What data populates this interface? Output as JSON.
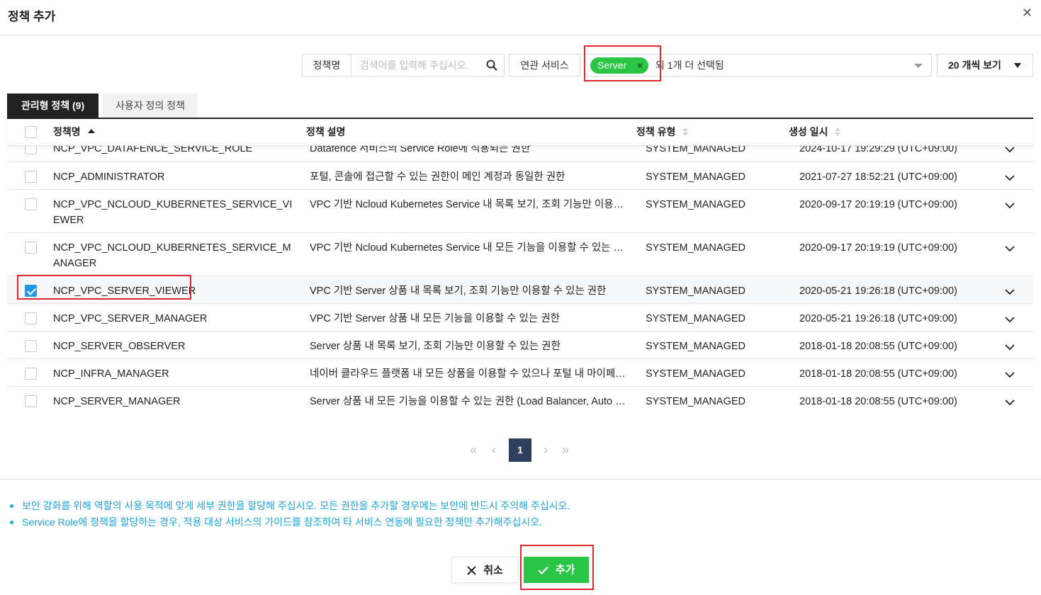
{
  "dialog": {
    "title": "정책 추가",
    "close_glyph": "✕"
  },
  "filter": {
    "search_label": "정책명",
    "search_placeholder": "검색어를 입력해 주십시오.",
    "service_label": "연관 서비스",
    "service_chip": "Server",
    "service_chip_remove": "×",
    "service_more": "외 1개 더 선택됨",
    "page_size": "20 개씩 보기"
  },
  "tabs": {
    "managed": "관리형 정책 (9)",
    "custom": "사용자 정의 정책"
  },
  "table": {
    "headers": {
      "name": "정책명",
      "desc": "정책 설명",
      "type": "정책 유형",
      "date": "생성 일시"
    },
    "rows": [
      {
        "name": "NCP_VPC_DATAFENCE_SERVICE_ROLE",
        "desc": "Datafence 서비스의 Service Role에 적용되는 권한",
        "type": "SYSTEM_MANAGED",
        "date": "2024-10-17 19:29:29 (UTC+09:00)",
        "checked": false
      },
      {
        "name": "NCP_ADMINISTRATOR",
        "desc": "포털, 콘솔에 접근할 수 있는 권한이 메인 계정과 동일한 권한",
        "type": "SYSTEM_MANAGED",
        "date": "2021-07-27 18:52:21 (UTC+09:00)",
        "checked": false
      },
      {
        "name": "NCP_VPC_NCLOUD_KUBERNETES_SERVICE_VIEWER",
        "desc": "VPC 기반 Ncloud Kubernetes Service 내 목록 보기, 조회 기능만 이용할 수 있는 권한",
        "type": "SYSTEM_MANAGED",
        "date": "2020-09-17 20:19:19 (UTC+09:00)",
        "checked": false
      },
      {
        "name": "NCP_VPC_NCLOUD_KUBERNETES_SERVICE_MANAGER",
        "desc": "VPC 기반 Ncloud Kubernetes Service 내 모든 기능을 이용할 수 있는 권한",
        "type": "SYSTEM_MANAGED",
        "date": "2020-09-17 20:19:19 (UTC+09:00)",
        "checked": false
      },
      {
        "name": "NCP_VPC_SERVER_VIEWER",
        "desc": "VPC 기반 Server 상품 내 목록 보기, 조회 기능만 이용할 수 있는 권한",
        "type": "SYSTEM_MANAGED",
        "date": "2020-05-21 19:26:18 (UTC+09:00)",
        "checked": true
      },
      {
        "name": "NCP_VPC_SERVER_MANAGER",
        "desc": "VPC 기반 Server 상품 내 모든 기능을 이용할 수 있는 권한",
        "type": "SYSTEM_MANAGED",
        "date": "2020-05-21 19:26:18 (UTC+09:00)",
        "checked": false
      },
      {
        "name": "NCP_SERVER_OBSERVER",
        "desc": "Server 상품 내 목록 보기, 조회 기능만 이용할 수 있는 권한",
        "type": "SYSTEM_MANAGED",
        "date": "2018-01-18 20:08:55 (UTC+09:00)",
        "checked": false
      },
      {
        "name": "NCP_INFRA_MANAGER",
        "desc": "네이버 클라우드 플랫폼 내 모든 상품을 이용할 수 있으나 포털 내 마이페이지 이용은 제한되는 권한",
        "type": "SYSTEM_MANAGED",
        "date": "2018-01-18 20:08:55 (UTC+09:00)",
        "checked": false
      },
      {
        "name": "NCP_SERVER_MANAGER",
        "desc": "Server 상품 내 모든 기능을 이용할 수 있는 권한 (Load Balancer, Auto Scaling 포함)",
        "type": "SYSTEM_MANAGED",
        "date": "2018-01-18 20:08:55 (UTC+09:00)",
        "checked": false
      }
    ]
  },
  "pagination": {
    "current": "1",
    "first": "«",
    "prev": "‹",
    "next": "›",
    "last": "»"
  },
  "notices": [
    "보안 강화를 위해 역할의 사용 목적에 맞게 세부 권한을 할당해 주십시오. 모든 권한을 추가할 경우에는 보안에 반드시 주의해 주십시오.",
    "Service Role에 정책을 할당하는 경우, 적용 대상 서비스의 가이드를 참조하여 타 서비스 연동에 필요한 정책만 추가해주십시오."
  ],
  "buttons": {
    "cancel": "취소",
    "add": "추가"
  },
  "colors": {
    "accent_green": "#2ac544",
    "info_blue": "#1aa5de",
    "highlight_red": "#e0262f",
    "pager_active": "#2e3f5e"
  }
}
